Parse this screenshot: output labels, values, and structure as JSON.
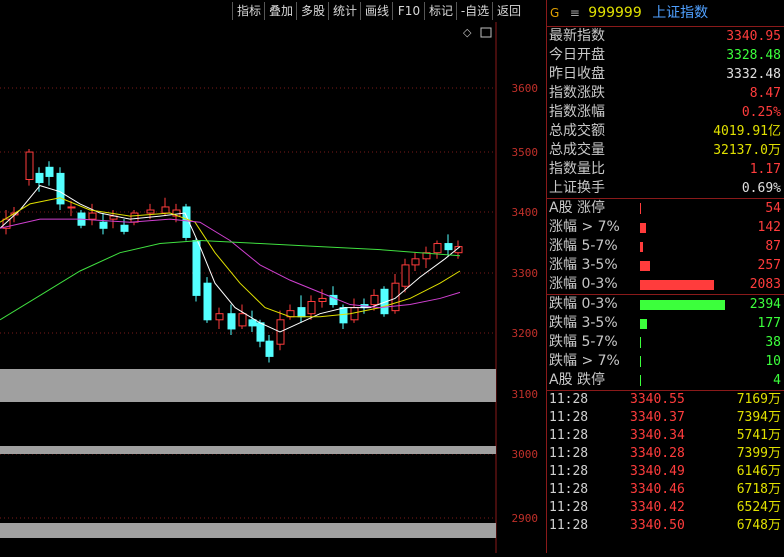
{
  "toolbar": [
    "指标",
    "叠加",
    "多股",
    "统计",
    "画线",
    "F10",
    "标记",
    "-自选",
    "返回"
  ],
  "chart": {
    "y_ticks": [
      "3600",
      "3500",
      "3400",
      "3300",
      "3200",
      "3100",
      "3000",
      "2900"
    ],
    "icons": [
      "diamond-icon",
      "window-icon"
    ]
  },
  "header": {
    "g": "G",
    "menu": "≡",
    "code": "999999",
    "name": "上证指数"
  },
  "stats": [
    {
      "label": "最新指数",
      "value": "3340.95",
      "color": "#ff3c3c"
    },
    {
      "label": "今日开盘",
      "value": "3328.48",
      "color": "#3cff3c"
    },
    {
      "label": "昨日收盘",
      "value": "3332.48",
      "color": "#e0e0e0"
    },
    {
      "label": "指数涨跌",
      "value": "8.47",
      "color": "#ff3c3c"
    },
    {
      "label": "指数涨幅",
      "value": "0.25%",
      "color": "#ff3c3c"
    },
    {
      "label": "总成交额",
      "value": "4019.91亿",
      "color": "#e0e000"
    },
    {
      "label": "总成交量",
      "value": "32137.0万",
      "color": "#e0e000"
    },
    {
      "label": "指数量比",
      "value": "1.17",
      "color": "#ff3c3c"
    },
    {
      "label": "上证换手",
      "value": "0.69%",
      "color": "#e0e0e0"
    }
  ],
  "up": [
    {
      "label": "A股 涨停",
      "value": "54",
      "fill": 0
    },
    {
      "label": "涨幅 > 7%",
      "value": "142",
      "fill": 0.07
    },
    {
      "label": "涨幅 5-7%",
      "value": "87",
      "fill": 0.04
    },
    {
      "label": "涨幅 3-5%",
      "value": "257",
      "fill": 0.12
    },
    {
      "label": "涨幅 0-3%",
      "value": "2083",
      "fill": 0.87
    }
  ],
  "down": [
    {
      "label": "跌幅 0-3%",
      "value": "2394",
      "fill": 1.0
    },
    {
      "label": "跌幅 3-5%",
      "value": "177",
      "fill": 0.08
    },
    {
      "label": "跌幅 5-7%",
      "value": "38",
      "fill": 0
    },
    {
      "label": "跌幅 > 7%",
      "value": "10",
      "fill": 0
    },
    {
      "label": "A股 跌停",
      "value": "4",
      "fill": 0
    }
  ],
  "ticks": [
    {
      "time": "11:28",
      "price": "3340.55",
      "vol": "7169万"
    },
    {
      "time": "11:28",
      "price": "3340.37",
      "vol": "7394万"
    },
    {
      "time": "11:28",
      "price": "3340.34",
      "vol": "5741万"
    },
    {
      "time": "11:28",
      "price": "3340.28",
      "vol": "7399万"
    },
    {
      "time": "11:28",
      "price": "3340.49",
      "vol": "6146万"
    },
    {
      "time": "11:28",
      "price": "3340.46",
      "vol": "6718万"
    },
    {
      "time": "11:28",
      "price": "3340.42",
      "vol": "6524万"
    },
    {
      "time": "11:28",
      "price": "3340.50",
      "vol": "6748万"
    }
  ]
}
